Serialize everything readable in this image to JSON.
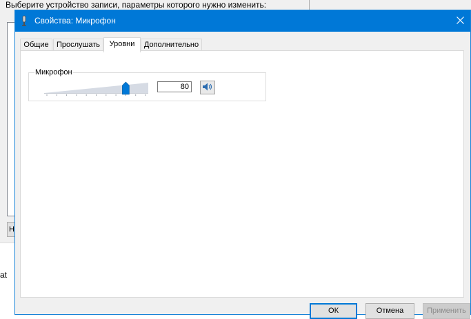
{
  "background": {
    "prompt": "Выберите устройство записи, параметры которого нужно изменить:",
    "button_fragment": "Н",
    "edge_text": "at"
  },
  "dialog": {
    "title": "Свойства: Микрофон",
    "icons": {
      "title": "microphone-icon",
      "close": "close-icon"
    },
    "tabs": [
      {
        "label": "Общие",
        "active": false
      },
      {
        "label": "Прослушать",
        "active": false
      },
      {
        "label": "Уровни",
        "active": true
      },
      {
        "label": "Дополнительно",
        "active": false
      }
    ],
    "levels": {
      "group_label": "Микрофон",
      "slider_value": 80,
      "slider_min": 0,
      "slider_max": 100,
      "value_text": "80",
      "mute_icon": "speaker-icon"
    },
    "buttons": {
      "ok": "ОК",
      "cancel": "Отмена",
      "apply": "Применить"
    },
    "colors": {
      "titlebar": "#0078d7",
      "accent": "#0078d7",
      "thumb": "#0078d7"
    }
  }
}
